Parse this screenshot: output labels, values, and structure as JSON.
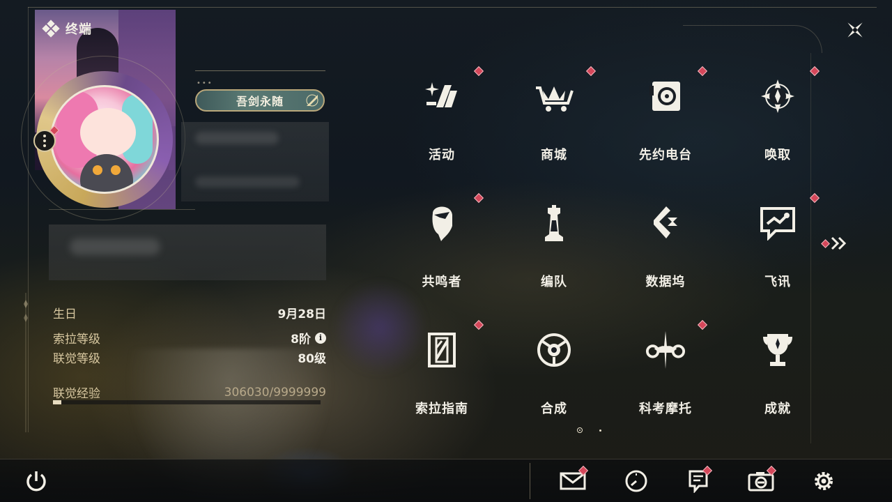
{
  "header": {
    "title": "终端",
    "icon": "diamond-cluster-icon"
  },
  "close": {
    "icon": "close-star-icon"
  },
  "profile": {
    "name_tag": "吾剑永随",
    "stats": [
      {
        "label": "生日",
        "value": "9月28日"
      },
      {
        "label": "索拉等级",
        "value": "8阶",
        "info_icon": "ⅰ"
      },
      {
        "label": "联觉等级",
        "value": "80级"
      }
    ],
    "exp": {
      "label": "联觉经验",
      "value": "306030/9999999",
      "progress": 0.0306
    }
  },
  "menu": {
    "items": [
      {
        "label": "活动",
        "icon": "sparkle-activity-icon",
        "badge": true
      },
      {
        "label": "商城",
        "icon": "shop-cart-icon",
        "badge": true
      },
      {
        "label": "先约电台",
        "icon": "radio-icon",
        "badge": true
      },
      {
        "label": "唤取",
        "icon": "convene-star-icon",
        "badge": true
      },
      {
        "label": "共鸣者",
        "icon": "resonator-head-icon",
        "badge": true
      },
      {
        "label": "编队",
        "icon": "chess-team-icon",
        "badge": false
      },
      {
        "label": "数据坞",
        "icon": "data-bank-icon",
        "badge": false
      },
      {
        "label": "飞讯",
        "icon": "message-chat-icon",
        "badge": true
      },
      {
        "label": "索拉指南",
        "icon": "guide-book-icon",
        "badge": true
      },
      {
        "label": "合成",
        "icon": "synthesis-icon",
        "badge": false
      },
      {
        "label": "科考摩托",
        "icon": "motorbike-icon",
        "badge": true
      },
      {
        "label": "成就",
        "icon": "trophy-icon",
        "badge": false
      }
    ],
    "next_icon": "double-chevron-right-icon",
    "pages": [
      true,
      false
    ]
  },
  "bottom_bar": {
    "power_icon": "power-icon",
    "icons": [
      {
        "name": "mail-icon",
        "badge": true
      },
      {
        "name": "clock-icon",
        "badge": false
      },
      {
        "name": "notice-icon",
        "badge": true
      },
      {
        "name": "camera-icon",
        "badge": true
      },
      {
        "name": "settings-gear-icon",
        "badge": false
      }
    ]
  },
  "colors": {
    "accent_gold": "#d8c8a0",
    "badge_red": "#d5475a",
    "text": "#f2efe6"
  }
}
